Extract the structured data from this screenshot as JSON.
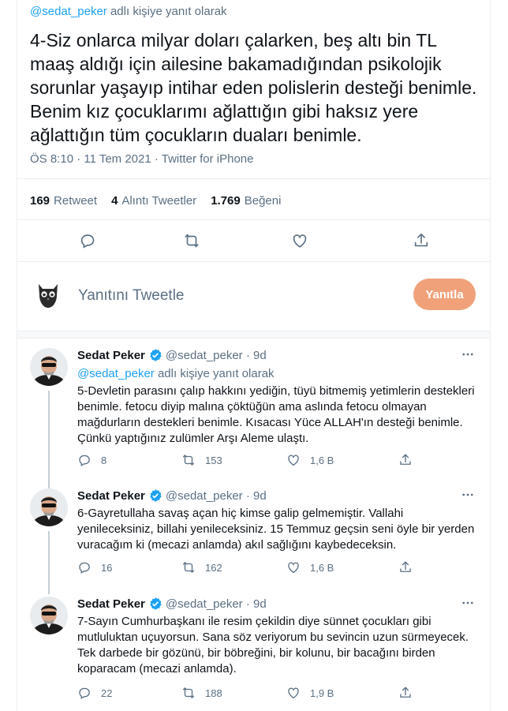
{
  "main_tweet": {
    "reply_handle": "@sedat_peker",
    "reply_suffix": " adlı kişiye yanıt olarak",
    "text": "4-Siz onlarca milyar doları çalarken, beş altı bin TL maaş aldığı için ailesine bakamadığından psikolojik sorunlar yaşayıp intihar eden polislerin desteği benimle. Benim kız çocuklarımı ağlattığın gibi haksız yere ağlattığın tüm çocukların duaları benimle.",
    "meta": "ÖS 8:10 · 11 Tem 2021 · Twitter for iPhone",
    "stats": {
      "retweets_num": "169",
      "retweets_label": "Retweet",
      "quotes_num": "4",
      "quotes_label": "Alıntı Tweetler",
      "likes_num": "1.769",
      "likes_label": "Beğeni"
    }
  },
  "reply_box": {
    "placeholder": "Yanıtını Tweetle",
    "button": "Yanıtla"
  },
  "colors": {
    "accent": "#1da1f2",
    "reply_button": "#f0a17a",
    "secondary_text": "#5b7083",
    "verified": "#1da1f2"
  },
  "replies": [
    {
      "name": "Sedat Peker",
      "handle": "@sedat_peker",
      "time": "· 9d",
      "reply_handle": "@sedat_peker",
      "reply_suffix": " adlı kişiye yanıt olarak",
      "text": "5-Devletin parasını çalıp hakkını yediğin, tüyü bitmemiş yetimlerin destekleri benimle. fetocu diyip malına çöktüğün ama aslında fetocu olmayan mağdurların destekleri benimle. Kısacası Yüce ALLAH'ın desteği benimle. Çünkü yaptığınız zulümler Arşı Aleme ulaştı.",
      "replies": "8",
      "retweets": "153",
      "likes": "1,6 B"
    },
    {
      "name": "Sedat Peker",
      "handle": "@sedat_peker",
      "time": "· 9d",
      "text": "6-Gayretullaha savaş açan hiç kimse galip gelmemiştir. Vallahi yenileceksiniz, billahi yenileceksiniz. 15 Temmuz geçsin seni öyle bir yerden vuracağım ki (mecazi anlamda) akıl sağlığını kaybedeceksin.",
      "replies": "16",
      "retweets": "162",
      "likes": "1,6 B"
    },
    {
      "name": "Sedat Peker",
      "handle": "@sedat_peker",
      "time": "· 9d",
      "text": "7-Sayın Cumhurbaşkanı ile resim çekildin diye sünnet çocukları gibi mutluluktan uçuyorsun. Sana söz veriyorum bu sevincin uzun sürmeyecek. Tek darbede bir gözünü, bir böbreğini, bir kolunu, bir bacağını birden koparacam (mecazi anlamda).",
      "replies": "22",
      "retweets": "188",
      "likes": "1,9 B"
    }
  ]
}
